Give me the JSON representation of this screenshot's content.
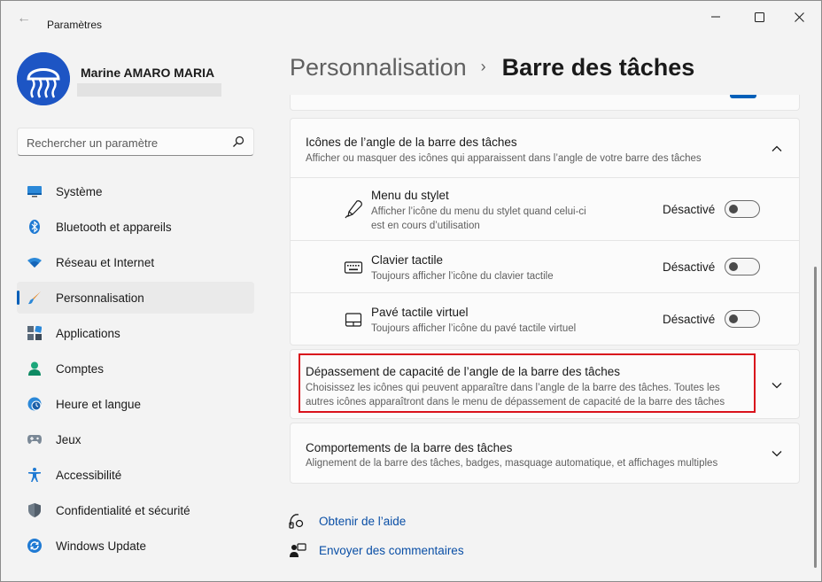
{
  "window": {
    "app_title": "Paramètres",
    "back_glyph": "←"
  },
  "profile": {
    "name": "Marine AMARO MARIA"
  },
  "search": {
    "placeholder": "Rechercher un paramètre"
  },
  "sidebar": {
    "items": [
      {
        "label": "Système",
        "icon": "monitor-icon"
      },
      {
        "label": "Bluetooth et appareils",
        "icon": "bluetooth-icon"
      },
      {
        "label": "Réseau et Internet",
        "icon": "wifi-icon"
      },
      {
        "label": "Personnalisation",
        "icon": "brush-icon",
        "active": true
      },
      {
        "label": "Applications",
        "icon": "apps-icon"
      },
      {
        "label": "Comptes",
        "icon": "person-icon"
      },
      {
        "label": "Heure et langue",
        "icon": "clock-globe-icon"
      },
      {
        "label": "Jeux",
        "icon": "gamepad-icon"
      },
      {
        "label": "Accessibilité",
        "icon": "accessibility-icon"
      },
      {
        "label": "Confidentialité et sécurité",
        "icon": "shield-icon"
      },
      {
        "label": "Windows Update",
        "icon": "update-icon"
      }
    ]
  },
  "breadcrumb": {
    "parent": "Personnalisation",
    "separator": "›",
    "current": "Barre des tâches"
  },
  "corner_icons": {
    "title": "Icônes de l’angle de la barre des tâches",
    "description": "Afficher ou masquer des icônes qui apparaissent dans l’angle de votre barre des tâches",
    "expanded": true,
    "rows": [
      {
        "title": "Menu du stylet",
        "description_line1": "Afficher l’icône du menu du stylet quand celui-ci",
        "description_line2": "est en cours d’utilisation",
        "state": "Désactivé",
        "on": false,
        "icon": "pen-icon"
      },
      {
        "title": "Clavier tactile",
        "description_line1": "Toujours afficher l’icône du clavier tactile",
        "state": "Désactivé",
        "on": false,
        "icon": "keyboard-icon"
      },
      {
        "title": "Pavé tactile virtuel",
        "description_line1": "Toujours afficher l’icône du pavé tactile virtuel",
        "state": "Désactivé",
        "on": false,
        "icon": "touchpad-icon"
      }
    ]
  },
  "overflow": {
    "title": "Dépassement de capacité de l’angle de la barre des tâches",
    "description_line1": "Choisissez les icônes qui peuvent apparaître dans l’angle de la barre des tâches. Toutes les",
    "description_line2": "autres icônes apparaîtront dans le menu de dépassement de capacité de la barre des tâches",
    "highlighted": true
  },
  "behaviors": {
    "title": "Comportements de la barre des tâches",
    "description": "Alignement de la barre des tâches, badges, masquage automatique, et affichages multiples"
  },
  "links": {
    "help": "Obtenir de l’aide",
    "feedback": "Envoyer des commentaires"
  },
  "colors": {
    "accent": "#005fb8",
    "highlight_border": "#d9121c",
    "link": "#0a4fa6"
  }
}
